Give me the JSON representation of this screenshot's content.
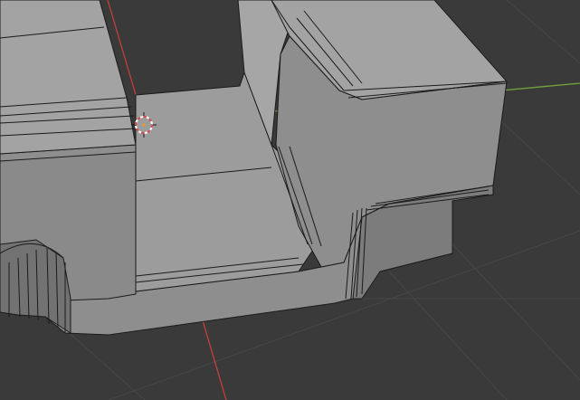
{
  "app": {
    "view": "3d-viewport",
    "mode": "edit",
    "selection_type": "edge"
  },
  "scene": {
    "object": "mesh",
    "shading": "solid",
    "background_color": "#3a3a3a",
    "grid_line_color": "#474747",
    "x_axis_color": "#c2403b",
    "y_axis_color": "#6fa13d",
    "mesh_light_color": "#a3a3a3",
    "mesh_mid_color": "#8e8e8e",
    "mesh_dark_color": "#727272",
    "edge_color": "#1b1b1b"
  },
  "cursor": {
    "icon": "3d-cursor-icon",
    "ring_colors": [
      "#d84a4a",
      "#ffffff"
    ]
  }
}
